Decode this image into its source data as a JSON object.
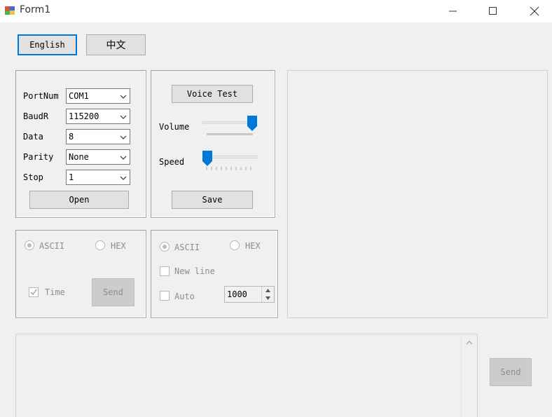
{
  "window": {
    "title": "Form1"
  },
  "language": {
    "english": "English",
    "chinese": "中文"
  },
  "serial": {
    "fields": [
      {
        "label": "PortNum",
        "value": "COM1"
      },
      {
        "label": "BaudR",
        "value": "115200"
      },
      {
        "label": "Data",
        "value": "8"
      },
      {
        "label": "Parity",
        "value": "None"
      },
      {
        "label": "Stop",
        "value": "1"
      }
    ],
    "open_label": "Open"
  },
  "voice": {
    "test_label": "Voice Test",
    "volume_label": "Volume",
    "volume_level": 1.0,
    "speed_label": "Speed",
    "speed_level": 0.0,
    "save_label": "Save"
  },
  "receive": {
    "ascii": "ASCII",
    "hex": "HEX",
    "time": "Time",
    "send": "Send"
  },
  "transmit": {
    "ascii": "ASCII",
    "hex": "HEX",
    "newline": "New line",
    "auto": "Auto",
    "interval": "1000"
  },
  "bottom": {
    "send": "Send"
  }
}
